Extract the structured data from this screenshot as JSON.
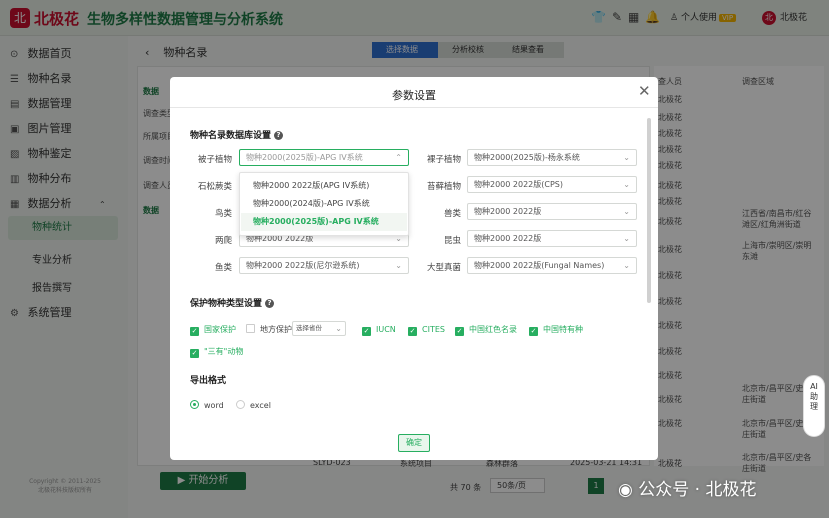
{
  "header": {
    "logo_text": "北",
    "brand": "北极花",
    "title": "生物多样性数据管理与分析系统",
    "user_menu": "个人使用",
    "user_badge": "VIP",
    "user_name": "北极花",
    "icons": [
      "shirt-icon",
      "edit-icon",
      "grid-icon",
      "bell-icon"
    ]
  },
  "sidebar": {
    "items": [
      {
        "label": "数据首页",
        "icon": "home-icon",
        "glyph": "⊙"
      },
      {
        "label": "物种名录",
        "icon": "list-icon",
        "glyph": "☰"
      },
      {
        "label": "数据管理",
        "icon": "folder-icon",
        "glyph": "▤"
      },
      {
        "label": "图片管理",
        "icon": "image-icon",
        "glyph": "▣"
      },
      {
        "label": "物种鉴定",
        "icon": "id-icon",
        "glyph": "▨"
      },
      {
        "label": "物种分布",
        "icon": "map-icon",
        "glyph": "▥"
      },
      {
        "label": "数据分析",
        "icon": "chart-icon",
        "glyph": "▦"
      }
    ],
    "sub_items": [
      "物种统计",
      "专业分析",
      "报告撰写"
    ],
    "system": {
      "label": "系统管理",
      "glyph": "⚙"
    },
    "copyright_1": "Copyright © 2011-2025",
    "copyright_2": "北极花科技版权所有"
  },
  "page": {
    "breadcrumb": "物种名录",
    "steps": [
      "选择数据",
      "分析校核",
      "结果查看"
    ],
    "start_button": "开始分析"
  },
  "background": {
    "left_labels": [
      "数据",
      "调查类型",
      "所属项目",
      "调查时间",
      "调查人员",
      "数据"
    ],
    "table_headers": [
      "查人员",
      "调查区域"
    ],
    "col1": [
      "北极花",
      "北极花",
      "北极花",
      "北极花",
      "北极花",
      "北极花",
      "北极花",
      "北极花",
      "北极花",
      "北极花",
      "北极花",
      "北极花",
      "北极花",
      "北极花",
      "北极花",
      "北极花"
    ],
    "regions": [
      "江西省/南昌市/红谷滩区/红角洲街道",
      "上海市/崇明区/崇明东滩",
      "北京市/昌平区/史各庄街道",
      "北京市/昌平区/史各庄街道",
      "北京市/昌平区/史各庄街道"
    ],
    "bottom_row": {
      "code": "SLYD-023",
      "project": "系统项目",
      "method": "森林群落",
      "time": "2025-03-21 14:31",
      "person": "北极花"
    },
    "total": "共 70 条",
    "page_size": "50条/页",
    "page_num": "1"
  },
  "dialog": {
    "title": "参数设置",
    "section_db": "物种名录数据库设置",
    "rows": [
      {
        "left_label": "被子植物",
        "left_value": "物种2000(2025版)-APG IV系统",
        "right_label": "裸子植物",
        "right_value": "物种2000(2025版)-杨永系统"
      },
      {
        "left_label": "石松蕨类",
        "left_value": "",
        "right_label": "苔藓植物",
        "right_value": "物种2000 2022版(CPS)"
      },
      {
        "left_label": "鸟类",
        "left_value": "",
        "right_label": "兽类",
        "right_value": "物种2000 2022版"
      },
      {
        "left_label": "两爬",
        "left_value": "物种2000 2022版",
        "right_label": "昆虫",
        "right_value": "物种2000 2022版"
      },
      {
        "left_label": "鱼类",
        "left_value": "物种2000 2022版(尼尔逊系统)",
        "right_label": "大型真菌",
        "right_value": "物种2000 2022版(Fungal Names)"
      }
    ],
    "dropdown_options": [
      "物种2000 2022版(APG IV系统)",
      "物种2000(2024版)-APG IV系统",
      "物种2000(2025版)-APG IV系统"
    ],
    "dropdown_selected_index": 2,
    "section_protect": "保护物种类型设置",
    "protect_options": [
      {
        "label": "国家保护",
        "checked": true
      },
      {
        "label": "地方保护",
        "checked": false
      },
      {
        "label": "IUCN",
        "checked": true
      },
      {
        "label": "CITES",
        "checked": true
      },
      {
        "label": "中国红色名录",
        "checked": true
      },
      {
        "label": "中国特有种",
        "checked": true
      },
      {
        "label": "\"三有\"动物",
        "checked": true
      }
    ],
    "region_placeholder": "选择省份",
    "section_export": "导出格式",
    "export_options": [
      {
        "label": "word",
        "selected": true
      },
      {
        "label": "excel",
        "selected": false
      }
    ],
    "ok_button": "确定"
  },
  "ai_button": {
    "line1": "AI",
    "line2": "助",
    "line3": "理"
  },
  "watermark": "公众号 · 北极花",
  "colors": {
    "brand": "#c8102e",
    "primary": "#1e7a46",
    "accent": "#27ae60",
    "step_active": "#2f6fd0"
  }
}
